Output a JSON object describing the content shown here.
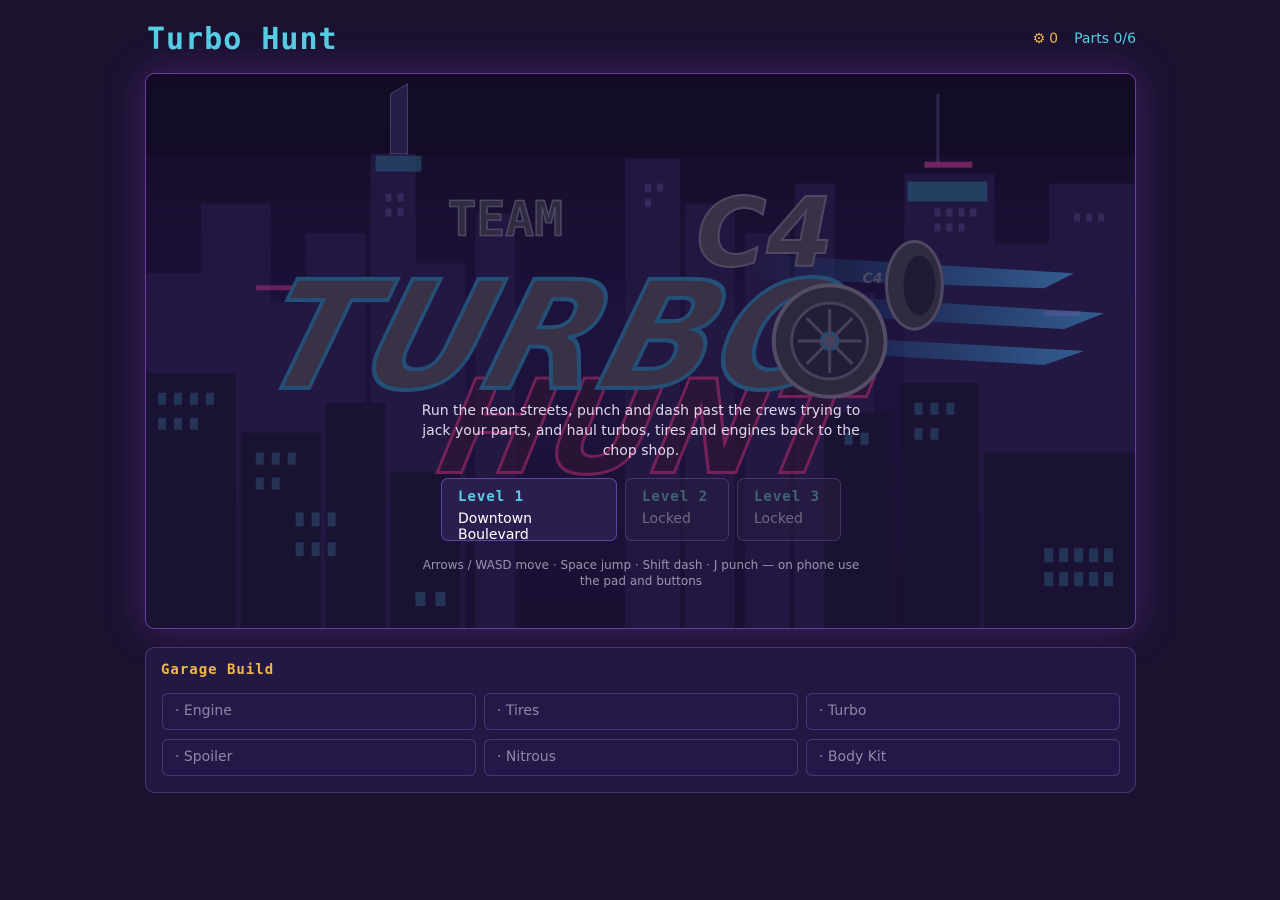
{
  "header": {
    "title": "Turbo Hunt",
    "coins_icon": "gear-icon",
    "coins": "0",
    "parts": "Parts 0/6"
  },
  "stage": {
    "logo": {
      "team": "TEAM",
      "c4": "C4",
      "turbo": "TURBO",
      "hunt": "HUNT",
      "turbo_badge": "C4"
    },
    "intro": "Run the neon streets, punch and dash past the crews trying to jack your parts, and haul turbos, tires and engines back to the chop shop.",
    "levels": [
      {
        "name": "Level 1",
        "subtitle": "Downtown Boulevard",
        "state": "unlocked"
      },
      {
        "name": "Level 2",
        "subtitle": "Locked",
        "state": "locked"
      },
      {
        "name": "Level 3",
        "subtitle": "Locked",
        "state": "locked"
      }
    ],
    "controls": "Arrows / WASD move · Space jump · Shift dash · J punch — on phone use the pad and buttons"
  },
  "garage": {
    "title": "Garage Build",
    "slots": [
      "· Engine",
      "· Tires",
      "· Turbo",
      "· Spoiler",
      "· Nitrous",
      "· Body Kit"
    ]
  },
  "colors": {
    "background": "#1b1230",
    "accent_cyan": "#56cfe4",
    "accent_gold": "#f0b64a",
    "border_purple": "#6a3e9e",
    "neon_pink": "#e0338f"
  }
}
